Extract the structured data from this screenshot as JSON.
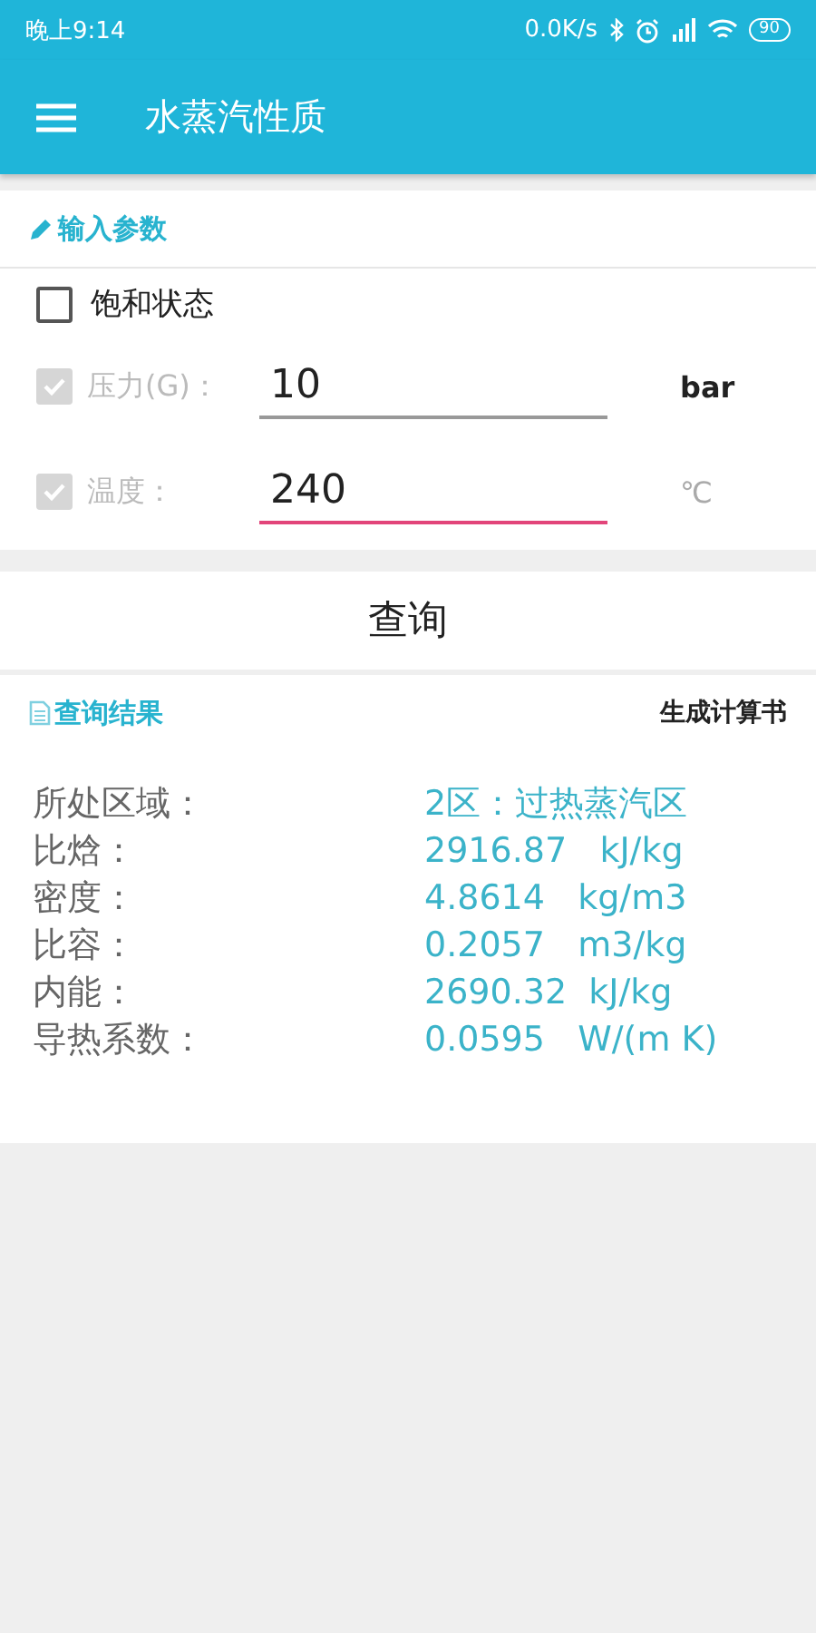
{
  "status_bar": {
    "time": "晚上9:14",
    "speed": "0.0K/s",
    "battery": "90"
  },
  "app_bar": {
    "title": "水蒸汽性质"
  },
  "input_section": {
    "title": "输入参数",
    "saturation": {
      "label": "饱和状态",
      "checked": false
    },
    "params": [
      {
        "label": "压力(G)：",
        "checked": true,
        "disabled": true,
        "value": "10",
        "focused": false,
        "unit": "bar",
        "unit_disabled": false
      },
      {
        "label": "温度：",
        "checked": true,
        "disabled": true,
        "value": "240",
        "focused": true,
        "unit": "℃",
        "unit_disabled": true
      }
    ]
  },
  "query_button": "查询",
  "results": {
    "title": "查询结果",
    "report_link": "生成计算书",
    "rows": [
      {
        "label": "所处区域：",
        "value": "2区：过热蒸汽区"
      },
      {
        "label": "比焓：",
        "value": "2916.87   kJ/kg"
      },
      {
        "label": "密度：",
        "value": "4.8614   kg/m3"
      },
      {
        "label": "比容：",
        "value": "0.2057   m3/kg"
      },
      {
        "label": "内能：",
        "value": "2690.32  kJ/kg"
      },
      {
        "label": "导热系数：",
        "value": "0.0595   W/(m K)"
      }
    ]
  }
}
